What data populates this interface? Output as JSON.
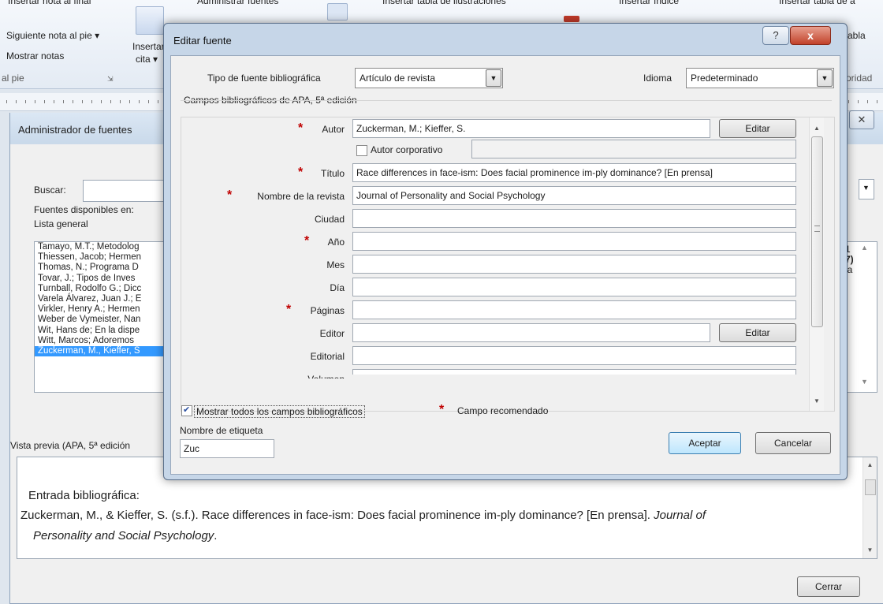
{
  "ribbon": {
    "insert_endnote": "Insertar nota al final",
    "next_footnote": "Siguiente nota al pie",
    "show_notes": "Mostrar notas",
    "footnotes_group": "al pie",
    "insert_citation_line1": "Insertar",
    "insert_citation_line2": "cita",
    "manage_sources": "Administrar fuentes",
    "insert_table_figures": "Insertar tabla de ilustraciones",
    "insert_index": "Insertar índice",
    "insert_table_auth": "Insertar tabla de a",
    "table_partial": "abla",
    "authorities_partial": "oridad"
  },
  "source_manager": {
    "title": "Administrador de fuentes",
    "search_label": "Buscar:",
    "sources_available_label": "Fuentes disponibles en:",
    "master_list_label": "Lista general",
    "sources": [
      "Tamayo, M.T.; Metodolog",
      "Thiessen, Jacob; Hermen",
      "Thomas, N.; Programa D",
      "Tovar, J.; Tipos de Inves",
      "Turnball, Rodolfo G.; Dicc",
      "Varela Álvarez, Juan J.; E",
      "Virkler, Henry A.; Hermen",
      "Weber de Vymeister, Nan",
      "Wit, Hans de; En la dispe",
      "Witt, Marcos; Adoremos",
      "Zuckerman, M., Kieffer, S"
    ],
    "right_partial_1": "1",
    "right_partial_2": "7)",
    "right_partial_3": "ia",
    "preview_label": "Vista previa (APA, 5ª edición",
    "preview_heading": "Entrada bibliográfica:",
    "preview_line1": "Zuckerman, M., & Kieffer, S. (s.f.). Race differences in face-ism: Does facial prominence im-ply dominance? [En prensa]. ",
    "preview_journal_1": "Journal of",
    "preview_journal_2": "Personality and Social Psychology",
    "preview_end": ".",
    "close_button": "Cerrar"
  },
  "edit_dialog": {
    "title": "Editar fuente",
    "help_icon": "?",
    "close_icon": "x",
    "source_type_label": "Tipo de fuente bibliográfica",
    "source_type_value": "Artículo de revista",
    "language_label": "Idioma",
    "language_value": "Predeterminado",
    "group_label": "Campos bibliográficos de APA, 5ª edición",
    "fields": {
      "author_label": "Autor",
      "author_value": "Zuckerman, M.; Kieffer, S.",
      "corporate_author_label": "Autor corporativo",
      "title_label": "Título",
      "title_value": "Race differences in face-ism: Does facial prominence im-ply dominance? [En prensa]",
      "journal_label": "Nombre de la revista",
      "journal_value": "Journal of Personality and Social Psychology",
      "city_label": "Ciudad",
      "year_label": "Año",
      "month_label": "Mes",
      "day_label": "Día",
      "pages_label": "Páginas",
      "editor_label": "Editor",
      "publisher_label": "Editorial",
      "volume_label": "Volumen"
    },
    "edit_button": "Editar",
    "show_all_fields_label": "Mostrar todos los campos bibliográficos",
    "show_all_fields_checked": true,
    "recommended_label": "Campo recomendado",
    "tag_name_label": "Nombre de etiqueta",
    "tag_name_value": "Zuc",
    "ok_button": "Aceptar",
    "cancel_button": "Cancelar",
    "required_marker": "*"
  },
  "colors": {
    "selection": "#3399ff",
    "required": "#c00000",
    "close_button": "#c2422a"
  }
}
